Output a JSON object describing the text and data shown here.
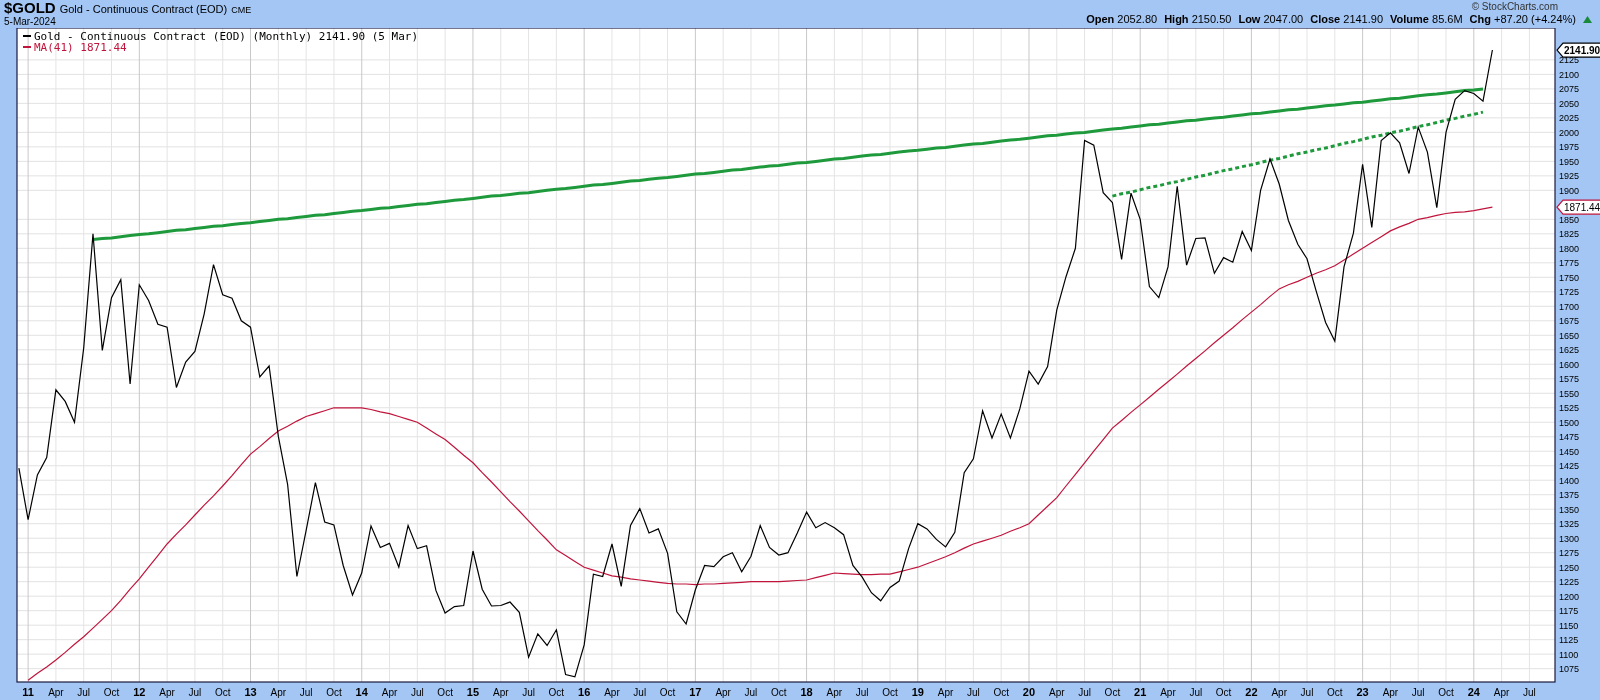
{
  "header": {
    "symbol": "$GOLD",
    "name": "Gold - Continuous Contract (EOD)",
    "exchange": "CME",
    "date": "5-Mar-2024",
    "copyright": "© StockCharts.com",
    "stats": [
      {
        "label": "Open",
        "value": "2052.80"
      },
      {
        "label": "High",
        "value": "2150.50"
      },
      {
        "label": "Low",
        "value": "2047.00"
      },
      {
        "label": "Close",
        "value": "2141.90"
      },
      {
        "label": "Volume",
        "value": "85.6M"
      }
    ],
    "change": {
      "label": "Chg",
      "value": "+87.20 (+4.24%)"
    }
  },
  "chart": {
    "chart_data": {
      "type": "line",
      "x": [
        2010.917,
        2011,
        2011.083,
        2011.167,
        2011.25,
        2011.333,
        2011.417,
        2011.5,
        2011.583,
        2011.667,
        2011.75,
        2011.833,
        2011.917,
        2012,
        2012.083,
        2012.167,
        2012.25,
        2012.333,
        2012.417,
        2012.5,
        2012.583,
        2012.667,
        2012.75,
        2012.833,
        2012.917,
        2013,
        2013.083,
        2013.167,
        2013.25,
        2013.333,
        2013.417,
        2013.5,
        2013.583,
        2013.667,
        2013.75,
        2013.833,
        2013.917,
        2014,
        2014.083,
        2014.167,
        2014.25,
        2014.333,
        2014.417,
        2014.5,
        2014.583,
        2014.667,
        2014.75,
        2014.833,
        2014.917,
        2015,
        2015.083,
        2015.167,
        2015.25,
        2015.333,
        2015.417,
        2015.5,
        2015.583,
        2015.667,
        2015.75,
        2015.833,
        2015.917,
        2016,
        2016.083,
        2016.167,
        2016.25,
        2016.333,
        2016.417,
        2016.5,
        2016.583,
        2016.667,
        2016.75,
        2016.833,
        2016.917,
        2017,
        2017.083,
        2017.167,
        2017.25,
        2017.333,
        2017.417,
        2017.5,
        2017.583,
        2017.667,
        2017.75,
        2017.833,
        2017.917,
        2018,
        2018.083,
        2018.167,
        2018.25,
        2018.333,
        2018.417,
        2018.5,
        2018.583,
        2018.667,
        2018.75,
        2018.833,
        2018.917,
        2019,
        2019.083,
        2019.167,
        2019.25,
        2019.333,
        2019.417,
        2019.5,
        2019.583,
        2019.667,
        2019.75,
        2019.833,
        2019.917,
        2020,
        2020.083,
        2020.167,
        2020.25,
        2020.333,
        2020.417,
        2020.5,
        2020.583,
        2020.667,
        2020.75,
        2020.833,
        2020.917,
        2021,
        2021.083,
        2021.167,
        2021.25,
        2021.333,
        2021.417,
        2021.5,
        2021.583,
        2021.667,
        2021.75,
        2021.833,
        2021.917,
        2022,
        2022.083,
        2022.167,
        2022.25,
        2022.333,
        2022.417,
        2022.5,
        2022.583,
        2022.667,
        2022.75,
        2022.833,
        2022.917,
        2023,
        2023.083,
        2023.167,
        2023.25,
        2023.333,
        2023.417,
        2023.5,
        2023.583,
        2023.667,
        2023.75,
        2023.833,
        2023.917,
        2024,
        2024.083,
        2024.167
      ],
      "series": [
        {
          "name": "Gold - Continuous Contract (EOD) (Monthly) 2141.90 (5 Mar)",
          "color": "#000000",
          "values": [
            1421,
            1332,
            1409,
            1439,
            1556,
            1536,
            1500,
            1628,
            1825,
            1624,
            1715,
            1746,
            1566,
            1737,
            1710,
            1669,
            1664,
            1560,
            1604,
            1622,
            1687,
            1772,
            1720,
            1714,
            1675,
            1664,
            1578,
            1597,
            1476,
            1393,
            1234,
            1313,
            1396,
            1328,
            1323,
            1253,
            1202,
            1240,
            1321,
            1284,
            1291,
            1250,
            1322,
            1282,
            1287,
            1210,
            1171,
            1182,
            1184,
            1278,
            1212,
            1183,
            1184,
            1190,
            1172,
            1095,
            1135,
            1115,
            1142,
            1065,
            1061,
            1116,
            1238,
            1234,
            1290,
            1217,
            1322,
            1351,
            1309,
            1316,
            1274,
            1173,
            1152,
            1211,
            1253,
            1251,
            1268,
            1275,
            1242,
            1269,
            1322,
            1284,
            1271,
            1275,
            1309,
            1345,
            1318,
            1327,
            1318,
            1306,
            1253,
            1233,
            1206,
            1192,
            1215,
            1226,
            1282,
            1325,
            1316,
            1298,
            1285,
            1310,
            1413,
            1437,
            1520,
            1473,
            1514,
            1473,
            1523,
            1588,
            1566,
            1596,
            1694,
            1751,
            1800,
            1986,
            1978,
            1896,
            1879,
            1781,
            1895,
            1850,
            1734,
            1715,
            1768,
            1907,
            1771,
            1817,
            1818,
            1757,
            1784,
            1776,
            1829,
            1796,
            1900,
            1954,
            1911,
            1848,
            1807,
            1782,
            1726,
            1672,
            1640,
            1768,
            1826,
            1945,
            1836,
            1986,
            1999,
            1982,
            1929,
            2009,
            1966,
            1870,
            2000,
            2057,
            2072,
            2067,
            2054,
            2142
          ]
        },
        {
          "name": "MA(41) 1871.44",
          "color": "#c0143c",
          "values": [
            null,
            1055,
            1067,
            1078,
            1090,
            1103,
            1117,
            1130,
            1145,
            1160,
            1175,
            1193,
            1212,
            1230,
            1250,
            1270,
            1290,
            1307,
            1323,
            1340,
            1357,
            1373,
            1390,
            1408,
            1427,
            1445,
            1458,
            1472,
            1485,
            1493,
            1502,
            1510,
            1515,
            1520,
            1525,
            1525,
            1525,
            1525,
            1522,
            1518,
            1515,
            1510,
            1505,
            1500,
            1490,
            1480,
            1470,
            1457,
            1443,
            1430,
            1413,
            1397,
            1380,
            1363,
            1347,
            1330,
            1313,
            1297,
            1280,
            1270,
            1260,
            1250,
            1245,
            1240,
            1235,
            1233,
            1230,
            1228,
            1226,
            1224,
            1222,
            1221,
            1221,
            1220,
            1221,
            1221,
            1222,
            1223,
            1224,
            1225,
            1225,
            1225,
            1225,
            1226,
            1227,
            1228,
            1232,
            1236,
            1240,
            1239,
            1238,
            1237,
            1237,
            1238,
            1238,
            1242,
            1246,
            1250,
            1256,
            1262,
            1268,
            1275,
            1283,
            1290,
            1295,
            1300,
            1305,
            1312,
            1318,
            1325,
            1340,
            1355,
            1370,
            1390,
            1410,
            1430,
            1450,
            1470,
            1490,
            1503,
            1517,
            1530,
            1543,
            1557,
            1570,
            1583,
            1597,
            1610,
            1623,
            1637,
            1650,
            1663,
            1677,
            1690,
            1703,
            1717,
            1730,
            1737,
            1743,
            1750,
            1757,
            1763,
            1770,
            1780,
            1790,
            1800,
            1810,
            1820,
            1830,
            1837,
            1843,
            1850,
            1853,
            1857,
            1860,
            1862,
            1863,
            1865,
            1868,
            1871
          ]
        },
        {
          "line_style": "solid",
          "color": "#1e9a3c",
          "values": [
            null,
            null,
            null,
            null,
            null,
            null,
            null,
            null,
            1815,
            1817,
            1818,
            1820,
            1822,
            1824,
            1825,
            1827,
            1829,
            1831,
            1832,
            1834,
            1836,
            1838,
            1839,
            1841,
            1843,
            1844,
            1846,
            1848,
            1850,
            1851,
            1853,
            1855,
            1857,
            1858,
            1860,
            1862,
            1864,
            1865,
            1867,
            1869,
            1870,
            1872,
            1874,
            1876,
            1877,
            1879,
            1881,
            1883,
            1884,
            1886,
            1888,
            1890,
            1891,
            1893,
            1895,
            1896,
            1898,
            1900,
            1902,
            1903,
            1905,
            1907,
            1909,
            1910,
            1912,
            1914,
            1916,
            1917,
            1919,
            1921,
            1922,
            1924,
            1926,
            1928,
            1929,
            1931,
            1933,
            1935,
            1936,
            1938,
            1940,
            1942,
            1943,
            1945,
            1947,
            1948,
            1950,
            1952,
            1954,
            1955,
            1957,
            1959,
            1961,
            1962,
            1964,
            1966,
            1968,
            1969,
            1971,
            1973,
            1974,
            1976,
            1978,
            1980,
            1981,
            1983,
            1985,
            1987,
            1988,
            1990,
            1992,
            1994,
            1995,
            1997,
            1999,
            2000,
            2002,
            2004,
            2006,
            2007,
            2009,
            2011,
            2013,
            2014,
            2016,
            2018,
            2020,
            2021,
            2023,
            2025,
            2026,
            2028,
            2030,
            2032,
            2033,
            2035,
            2037,
            2039,
            2040,
            2042,
            2044,
            2046,
            2047,
            2049,
            2051,
            2052,
            2054,
            2056,
            2058,
            2059,
            2061,
            2063,
            2065,
            2066,
            2068,
            2070,
            2072,
            2073,
            2075,
            null
          ]
        },
        {
          "line_style": "dashed",
          "color": "#1e9a3c",
          "values": [
            null,
            null,
            null,
            null,
            null,
            null,
            null,
            null,
            null,
            null,
            null,
            null,
            null,
            null,
            null,
            null,
            null,
            null,
            null,
            null,
            null,
            null,
            null,
            null,
            null,
            null,
            null,
            null,
            null,
            null,
            null,
            null,
            null,
            null,
            null,
            null,
            null,
            null,
            null,
            null,
            null,
            null,
            null,
            null,
            null,
            null,
            null,
            null,
            null,
            null,
            null,
            null,
            null,
            null,
            null,
            null,
            null,
            null,
            null,
            null,
            null,
            null,
            null,
            null,
            null,
            null,
            null,
            null,
            null,
            null,
            null,
            null,
            null,
            null,
            null,
            null,
            null,
            null,
            null,
            null,
            null,
            null,
            null,
            null,
            null,
            null,
            null,
            null,
            null,
            null,
            null,
            null,
            null,
            null,
            null,
            null,
            null,
            null,
            null,
            null,
            null,
            null,
            null,
            null,
            null,
            null,
            null,
            null,
            null,
            null,
            null,
            null,
            null,
            null,
            null,
            null,
            null,
            null,
            1890,
            1894,
            1897,
            1901,
            1905,
            1908,
            1912,
            1915,
            1919,
            1923,
            1926,
            1930,
            1934,
            1937,
            1941,
            1944,
            1948,
            1952,
            1955,
            1959,
            1963,
            1966,
            1970,
            1973,
            1977,
            1981,
            1984,
            1988,
            1992,
            1995,
            1999,
            2002,
            2006,
            2010,
            2013,
            2017,
            2021,
            2024,
            2028,
            2031,
            2035,
            null
          ]
        }
      ],
      "xlim": [
        2010.9,
        2024.73
      ],
      "ylim": [
        1052,
        2180
      ],
      "xticks": [
        {
          "value": 2011,
          "label": "11"
        },
        {
          "value": 2011.25,
          "label": "Apr"
        },
        {
          "value": 2011.5,
          "label": "Jul"
        },
        {
          "value": 2011.75,
          "label": "Oct"
        },
        {
          "value": 2012,
          "label": "12"
        },
        {
          "value": 2012.25,
          "label": "Apr"
        },
        {
          "value": 2012.5,
          "label": "Jul"
        },
        {
          "value": 2012.75,
          "label": "Oct"
        },
        {
          "value": 2013,
          "label": "13"
        },
        {
          "value": 2013.25,
          "label": "Apr"
        },
        {
          "value": 2013.5,
          "label": "Jul"
        },
        {
          "value": 2013.75,
          "label": "Oct"
        },
        {
          "value": 2014,
          "label": "14"
        },
        {
          "value": 2014.25,
          "label": "Apr"
        },
        {
          "value": 2014.5,
          "label": "Jul"
        },
        {
          "value": 2014.75,
          "label": "Oct"
        },
        {
          "value": 2015,
          "label": "15"
        },
        {
          "value": 2015.25,
          "label": "Apr"
        },
        {
          "value": 2015.5,
          "label": "Jul"
        },
        {
          "value": 2015.75,
          "label": "Oct"
        },
        {
          "value": 2016,
          "label": "16"
        },
        {
          "value": 2016.25,
          "label": "Apr"
        },
        {
          "value": 2016.5,
          "label": "Jul"
        },
        {
          "value": 2016.75,
          "label": "Oct"
        },
        {
          "value": 2017,
          "label": "17"
        },
        {
          "value": 2017.25,
          "label": "Apr"
        },
        {
          "value": 2017.5,
          "label": "Jul"
        },
        {
          "value": 2017.75,
          "label": "Oct"
        },
        {
          "value": 2018,
          "label": "18"
        },
        {
          "value": 2018.25,
          "label": "Apr"
        },
        {
          "value": 2018.5,
          "label": "Jul"
        },
        {
          "value": 2018.75,
          "label": "Oct"
        },
        {
          "value": 2019,
          "label": "19"
        },
        {
          "value": 2019.25,
          "label": "Apr"
        },
        {
          "value": 2019.5,
          "label": "Jul"
        },
        {
          "value": 2019.75,
          "label": "Oct"
        },
        {
          "value": 2020,
          "label": "20"
        },
        {
          "value": 2020.25,
          "label": "Apr"
        },
        {
          "value": 2020.5,
          "label": "Jul"
        },
        {
          "value": 2020.75,
          "label": "Oct"
        },
        {
          "value": 2021,
          "label": "21"
        },
        {
          "value": 2021.25,
          "label": "Apr"
        },
        {
          "value": 2021.5,
          "label": "Jul"
        },
        {
          "value": 2021.75,
          "label": "Oct"
        },
        {
          "value": 2022,
          "label": "22"
        },
        {
          "value": 2022.25,
          "label": "Apr"
        },
        {
          "value": 2022.5,
          "label": "Jul"
        },
        {
          "value": 2022.75,
          "label": "Oct"
        },
        {
          "value": 2023,
          "label": "23"
        },
        {
          "value": 2023.25,
          "label": "Apr"
        },
        {
          "value": 2023.5,
          "label": "Jul"
        },
        {
          "value": 2023.75,
          "label": "Oct"
        },
        {
          "value": 2024,
          "label": "24"
        },
        {
          "value": 2024.25,
          "label": "Apr"
        },
        {
          "value": 2024.5,
          "label": "Jul"
        }
      ],
      "yticks": [
        1075,
        1100,
        1125,
        1150,
        1175,
        1200,
        1225,
        1250,
        1275,
        1300,
        1325,
        1350,
        1375,
        1400,
        1425,
        1450,
        1475,
        1500,
        1525,
        1550,
        1575,
        1600,
        1625,
        1650,
        1675,
        1700,
        1725,
        1750,
        1775,
        1800,
        1825,
        1850,
        1900,
        1925,
        1950,
        1975,
        2000,
        2025,
        2050,
        2075,
        2100,
        2125
      ],
      "grid": true,
      "legend": true
    },
    "price_tags": [
      {
        "label": "2141.90"
      },
      {
        "label": "1871.44"
      }
    ]
  }
}
